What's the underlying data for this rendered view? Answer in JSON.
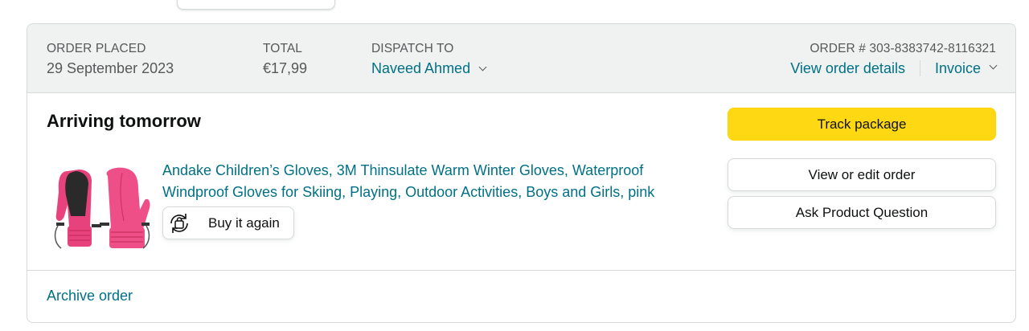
{
  "header": {
    "order_placed_label": "ORDER PLACED",
    "order_placed_value": "29 September 2023",
    "total_label": "TOTAL",
    "total_value": "€17,99",
    "dispatch_label": "DISPATCH TO",
    "dispatch_value": "Naveed Ahmed",
    "order_number": "ORDER # 303-8383742-8116321",
    "view_details_label": "View order details",
    "invoice_label": "Invoice"
  },
  "shipment": {
    "status_title": "Arriving tomorrow",
    "product_title": "Andake Children’s Gloves, 3M Thinsulate Warm Winter Gloves, Waterproof Windproof Gloves for Skiing, Playing, Outdoor Activities, Boys and Girls, pink",
    "buy_again_label": "Buy it again"
  },
  "actions": {
    "track_label": "Track package",
    "edit_label": "View or edit order",
    "ask_label": "Ask Product Question"
  },
  "footer": {
    "archive_label": "Archive order"
  },
  "colors": {
    "link": "#007185",
    "track_button": "#FFD814",
    "header_bg": "#F0F2F2",
    "product_pink": "#E8427C"
  },
  "icons": {
    "dispatch_toggle": "chevron-down-icon",
    "invoice_toggle": "chevron-down-icon",
    "buy_again": "reorder-bag-icon"
  }
}
